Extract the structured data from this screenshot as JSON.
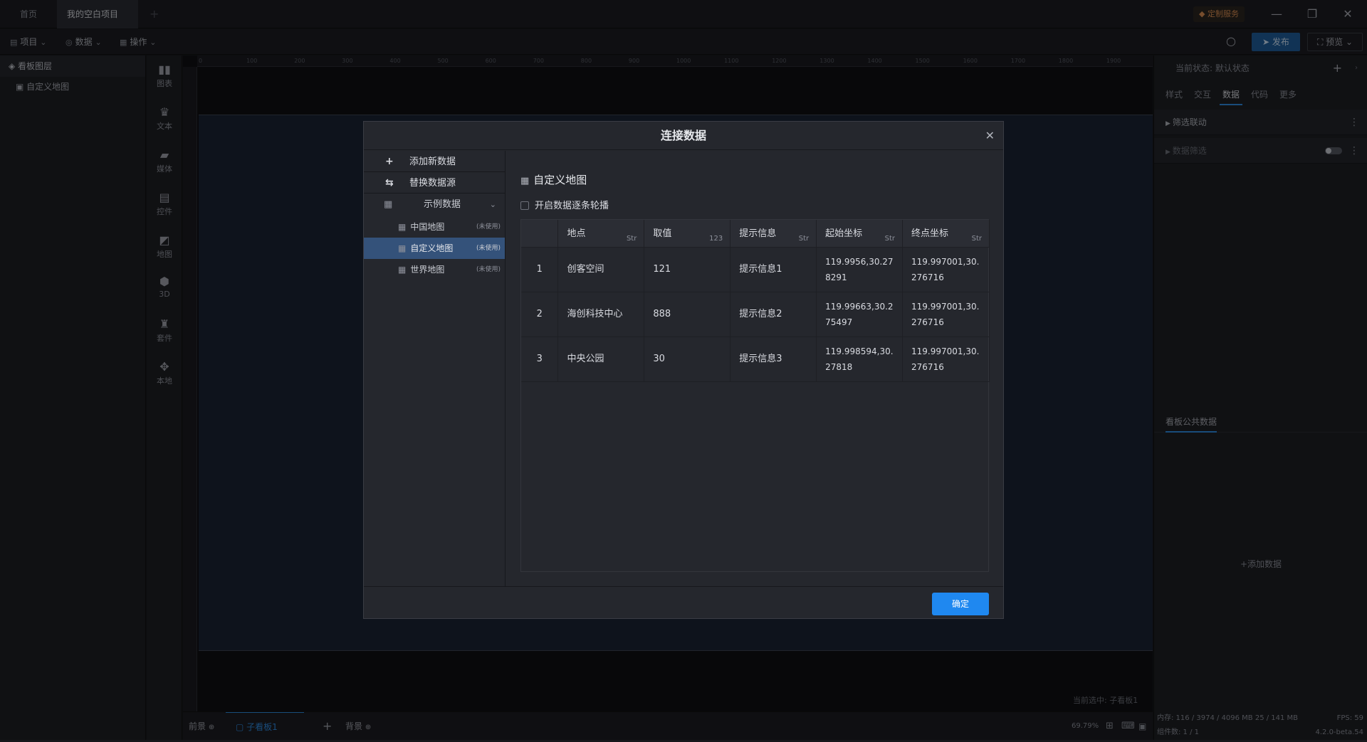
{
  "titlebar": {
    "tabs": [
      {
        "label": "首页"
      },
      {
        "label": "我的空白项目"
      }
    ],
    "custom_service": "定制服务"
  },
  "toolbar": {
    "menus": [
      {
        "label": "项目"
      },
      {
        "label": "数据"
      },
      {
        "label": "操作"
      }
    ],
    "publish": "发布",
    "preview": "预览"
  },
  "layers": {
    "header": "看板图层",
    "items": [
      {
        "label": "自定义地图"
      }
    ]
  },
  "components": [
    {
      "label": "图表",
      "icon": "chart-icon"
    },
    {
      "label": "文本",
      "icon": "text-icon"
    },
    {
      "label": "媒体",
      "icon": "media-icon"
    },
    {
      "label": "控件",
      "icon": "control-icon"
    },
    {
      "label": "地图",
      "icon": "map-icon"
    },
    {
      "label": "3D",
      "icon": "cube-icon"
    },
    {
      "label": "套件",
      "icon": "suite-icon"
    },
    {
      "label": "本地",
      "icon": "local-icon"
    }
  ],
  "ruler": {
    "top_ticks": [
      "0",
      "100",
      "200",
      "300",
      "400",
      "500",
      "600",
      "700",
      "800",
      "900",
      "1000",
      "1100",
      "1200",
      "1300",
      "1400",
      "1500",
      "1600",
      "1700",
      "1800",
      "1900"
    ]
  },
  "canvas": {
    "current_selection": "当前选中: 子看板1"
  },
  "canvas_bottom": {
    "front": "前景",
    "sub_board": "子看板1",
    "background": "背景",
    "zoom": "69.79%"
  },
  "right_panel": {
    "state": "当前状态:  默认状态",
    "tabs": [
      {
        "label": "样式"
      },
      {
        "label": "交互"
      },
      {
        "label": "数据"
      },
      {
        "label": "代码"
      },
      {
        "label": "更多"
      }
    ],
    "sections": [
      {
        "label": "筛选联动"
      },
      {
        "label": "数据筛选"
      }
    ],
    "public_data_tab": "看板公共数据",
    "add_data": "+添加数据",
    "memory": "内存:  116 / 3974 / 4096 MB  25 / 141 MB",
    "fps": "FPS:  59",
    "component_count": "组件数: 1 / 1",
    "version": "4.2.0-beta.54"
  },
  "modal": {
    "title": "连接数据",
    "actions": [
      {
        "label": "添加新数据"
      },
      {
        "label": "替换数据源"
      }
    ],
    "group": "示例数据",
    "datasets": [
      {
        "label": "中国地图",
        "tag": "(未使用)"
      },
      {
        "label": "自定义地图",
        "tag": "(未使用)"
      },
      {
        "label": "世界地图",
        "tag": "(未使用)"
      }
    ],
    "dataset_title": "自定义地图",
    "carousel_label": "开启数据逐条轮播",
    "columns": [
      {
        "label": "",
        "type": ""
      },
      {
        "label": "地点",
        "type": "Str"
      },
      {
        "label": "取值",
        "type": "123"
      },
      {
        "label": "提示信息",
        "type": "Str"
      },
      {
        "label": "起始坐标",
        "type": "Str"
      },
      {
        "label": "终点坐标",
        "type": "Str"
      }
    ],
    "rows": [
      [
        "1",
        "创客空间",
        "121",
        "提示信息1",
        "119.9956,30.278291",
        "119.997001,30.276716"
      ],
      [
        "2",
        "海创科技中心",
        "888",
        "提示信息2",
        "119.99663,30.275497",
        "119.997001,30.276716"
      ],
      [
        "3",
        "中央公园",
        "30",
        "提示信息3",
        "119.998594,30.27818",
        "119.997001,30.276716"
      ]
    ],
    "confirm": "确定"
  }
}
